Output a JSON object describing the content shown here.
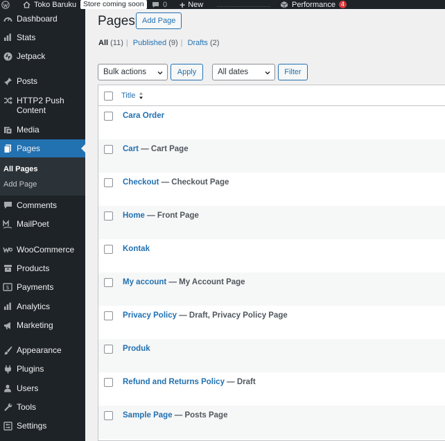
{
  "adminbar": {
    "site_name": "Toko Baruku",
    "store_badge": "Store coming soon",
    "comments_count": "0",
    "new_label": "New",
    "performance_label": "Performance",
    "performance_count": "4"
  },
  "sidebar": {
    "items": [
      {
        "label": "Dashboard",
        "icon": "dashboard-icon"
      },
      {
        "label": "Stats",
        "icon": "stats-icon"
      },
      {
        "label": "Jetpack",
        "icon": "jetpack-icon"
      },
      {
        "label": "Posts",
        "icon": "pin-icon"
      },
      {
        "label": "HTTP2 Push Content",
        "icon": "shuffle-icon"
      },
      {
        "label": "Media",
        "icon": "media-icon"
      },
      {
        "label": "Pages",
        "icon": "pages-icon"
      },
      {
        "label": "Comments",
        "icon": "comment-icon"
      },
      {
        "label": "MailPoet",
        "icon": "mailpoet-icon"
      },
      {
        "label": "WooCommerce",
        "icon": "woocommerce-icon"
      },
      {
        "label": "Products",
        "icon": "archive-icon"
      },
      {
        "label": "Payments",
        "icon": "payments-icon"
      },
      {
        "label": "Analytics",
        "icon": "analytics-icon"
      },
      {
        "label": "Marketing",
        "icon": "megaphone-icon"
      },
      {
        "label": "Appearance",
        "icon": "brush-icon"
      },
      {
        "label": "Plugins",
        "icon": "plugin-icon"
      },
      {
        "label": "Users",
        "icon": "users-icon"
      },
      {
        "label": "Tools",
        "icon": "wrench-icon"
      },
      {
        "label": "Settings",
        "icon": "settings-icon"
      }
    ],
    "submenu": {
      "all_pages": "All Pages",
      "add_page": "Add Page"
    }
  },
  "main": {
    "title": "Pages",
    "add_button": "Add Page",
    "filters": {
      "all": "All",
      "all_count": "(11)",
      "published": "Published",
      "published_count": "(9)",
      "drafts": "Drafts",
      "drafts_count": "(2)",
      "separator": "|"
    },
    "bulk_actions": "Bulk actions",
    "apply": "Apply",
    "dates": "All dates",
    "filter": "Filter",
    "table": {
      "title_header": "Title",
      "rows": [
        {
          "title": "Cara Order",
          "state": ""
        },
        {
          "title": "Cart",
          "state": " — Cart Page"
        },
        {
          "title": "Checkout",
          "state": " — Checkout Page"
        },
        {
          "title": "Home",
          "state": " — Front Page"
        },
        {
          "title": "Kontak",
          "state": ""
        },
        {
          "title": "My account",
          "state": " — My Account Page"
        },
        {
          "title": "Privacy Policy",
          "state": " — Draft, Privacy Policy Page"
        },
        {
          "title": "Produk",
          "state": ""
        },
        {
          "title": "Refund and Returns Policy",
          "state": " — Draft"
        },
        {
          "title": "Sample Page",
          "state": " — Posts Page"
        }
      ]
    }
  },
  "colors": {
    "accent": "#2271b1",
    "sidebar_bg": "#1d2327",
    "active_menu": "#2271b1",
    "badge": "#d63638"
  }
}
